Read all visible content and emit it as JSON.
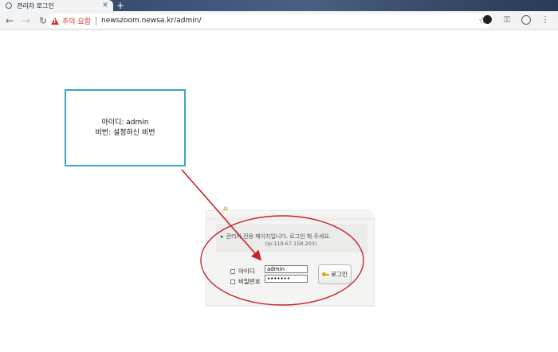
{
  "browser": {
    "tab_title": "관리자 로그인",
    "tab_close": "✕",
    "new_tab": "+",
    "back": "←",
    "forward": "→",
    "reload": "↻",
    "security_label": "주의 요함",
    "url": "newszoom.newsa.kr/admin/",
    "star": "☆",
    "key_icon": "⚿",
    "menu_icon": "⋮"
  },
  "note": {
    "line1": "아이디: admin",
    "line2": "비번: 설정하신 비번"
  },
  "login": {
    "notice": "관리자 전용 페이지입니다. 로그인 해 주세요.",
    "ip": "(ip:119.67.158.203)",
    "id_label": "아이디",
    "id_value": "admin",
    "pw_label": "비밀번호",
    "pw_value": "•••••••",
    "button_label": "로그인"
  },
  "colors": {
    "annotation_red": "#c8232c",
    "note_border": "#3aa6c0",
    "warning_red": "#d93025"
  }
}
